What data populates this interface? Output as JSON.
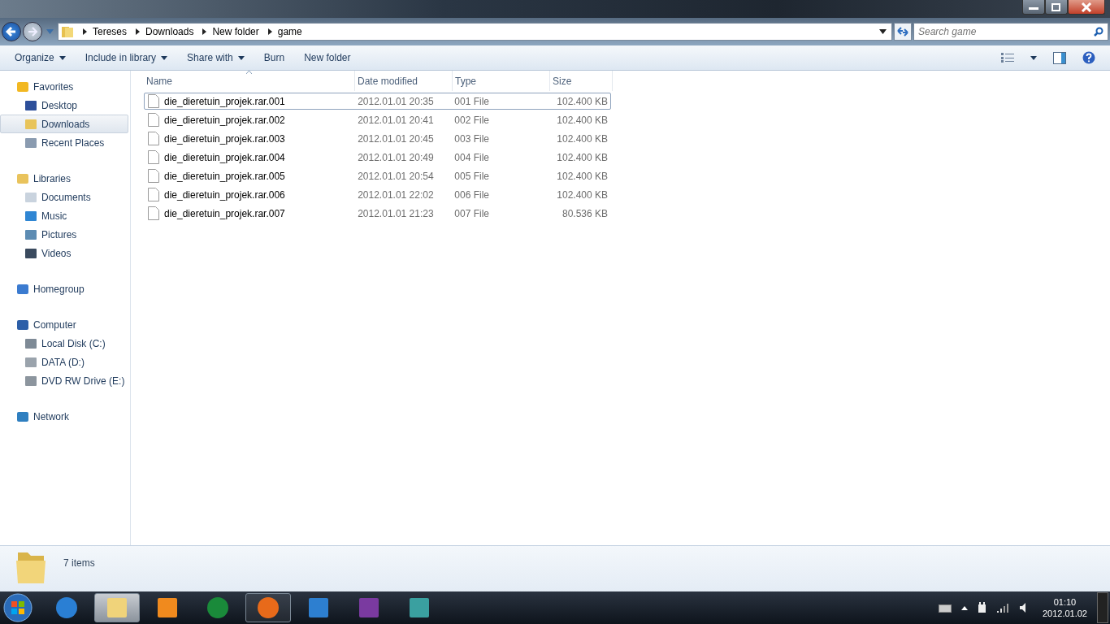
{
  "address_bar": {
    "breadcrumb": [
      "Tereses",
      "Downloads",
      "New folder",
      "game"
    ]
  },
  "search": {
    "placeholder": "Search game"
  },
  "toolbar": [
    {
      "label": "Organize",
      "dropdown": true
    },
    {
      "label": "Include in library",
      "dropdown": true
    },
    {
      "label": "Share with",
      "dropdown": true
    },
    {
      "label": "Burn",
      "dropdown": false
    },
    {
      "label": "New folder",
      "dropdown": false
    }
  ],
  "sidebar": [
    {
      "label": "Favorites",
      "children": [
        {
          "label": "Desktop",
          "selected": false
        },
        {
          "label": "Downloads",
          "selected": true
        },
        {
          "label": "Recent Places",
          "selected": false
        }
      ]
    },
    {
      "label": "Libraries",
      "children": [
        {
          "label": "Documents",
          "selected": false
        },
        {
          "label": "Music",
          "selected": false
        },
        {
          "label": "Pictures",
          "selected": false
        },
        {
          "label": "Videos",
          "selected": false
        }
      ]
    },
    {
      "label": "Homegroup"
    },
    {
      "label": "Computer",
      "children": [
        {
          "label": "Local Disk (C:)",
          "selected": false
        },
        {
          "label": "DATA (D:)",
          "selected": false
        },
        {
          "label": "DVD RW Drive (E:)",
          "selected": false
        }
      ]
    },
    {
      "label": "Network"
    }
  ],
  "table": {
    "columns": [
      {
        "label": "Name",
        "sorted": true
      },
      {
        "label": "Date modified",
        "sorted": false
      },
      {
        "label": "Type",
        "sorted": false
      },
      {
        "label": "Size",
        "sorted": false
      }
    ],
    "rows": [
      {
        "name": "die_dieretuin_projek.rar.001",
        "date": "2012.01.01 20:35",
        "type": "001 File",
        "size": "102.400 KB",
        "focused": true
      },
      {
        "name": "die_dieretuin_projek.rar.002",
        "date": "2012.01.01 20:41",
        "type": "002 File",
        "size": "102.400 KB",
        "focused": false
      },
      {
        "name": "die_dieretuin_projek.rar.003",
        "date": "2012.01.01 20:45",
        "type": "003 File",
        "size": "102.400 KB",
        "focused": false
      },
      {
        "name": "die_dieretuin_projek.rar.004",
        "date": "2012.01.01 20:49",
        "type": "004 File",
        "size": "102.400 KB",
        "focused": false
      },
      {
        "name": "die_dieretuin_projek.rar.005",
        "date": "2012.01.01 20:54",
        "type": "005 File",
        "size": "102.400 KB",
        "focused": false
      },
      {
        "name": "die_dieretuin_projek.rar.006",
        "date": "2012.01.01 22:02",
        "type": "006 File",
        "size": "102.400 KB",
        "focused": false
      },
      {
        "name": "die_dieretuin_projek.rar.007",
        "date": "2012.01.01 21:23",
        "type": "007 File",
        "size": "80.536 KB",
        "focused": false
      }
    ]
  },
  "status_bar": {
    "item_count": "7 items"
  },
  "taskbar": {
    "apps": [
      {
        "running": false,
        "selected": false
      },
      {
        "running": true,
        "selected": true
      },
      {
        "running": false,
        "selected": false
      },
      {
        "running": false,
        "selected": false
      },
      {
        "running": true,
        "selected": false
      },
      {
        "running": false,
        "selected": false
      },
      {
        "running": false,
        "selected": false
      },
      {
        "running": false,
        "selected": false
      }
    ],
    "clock": {
      "time": "01:10",
      "date": "2012.01.02"
    }
  }
}
